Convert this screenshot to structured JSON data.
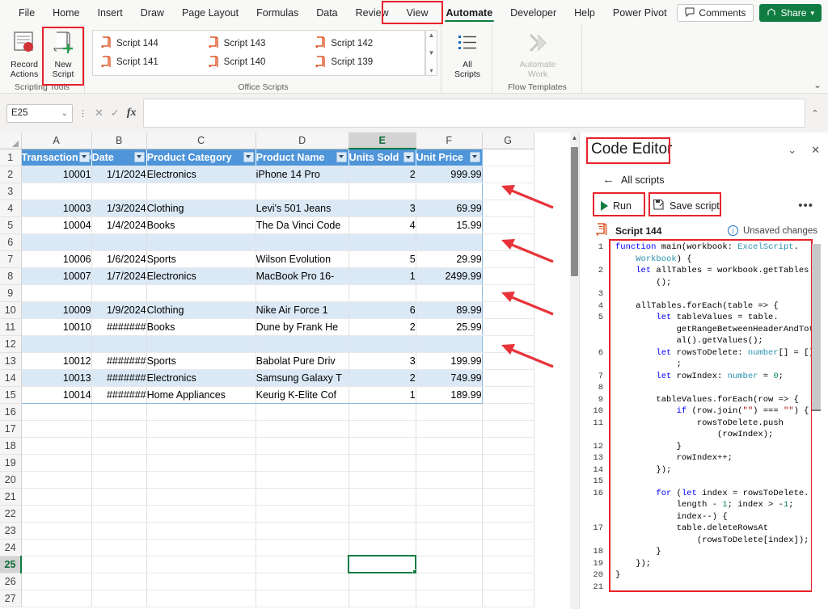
{
  "ribbon": {
    "tabs": [
      {
        "label": "File",
        "active": false
      },
      {
        "label": "Home",
        "active": false
      },
      {
        "label": "Insert",
        "active": false
      },
      {
        "label": "Draw",
        "active": false
      },
      {
        "label": "Page Layout",
        "active": false
      },
      {
        "label": "Formulas",
        "active": false
      },
      {
        "label": "Data",
        "active": false
      },
      {
        "label": "Review",
        "active": false
      },
      {
        "label": "View",
        "active": false
      },
      {
        "label": "Automate",
        "active": true
      },
      {
        "label": "Developer",
        "active": false
      },
      {
        "label": "Help",
        "active": false
      },
      {
        "label": "Power Pivot",
        "active": false
      }
    ],
    "comments_label": "Comments",
    "share_label": "Share",
    "collapse_glyph": "⌄",
    "groups": {
      "scripting_tools": {
        "label": "Scripting Tools",
        "record_actions": "Record\nActions",
        "record_actions_line1": "Record",
        "record_actions_line2": "Actions",
        "new_script_line1": "New",
        "new_script_line2": "Script"
      },
      "office_scripts": {
        "label": "Office Scripts",
        "items": [
          {
            "label": "Script 144"
          },
          {
            "label": "Script 143"
          },
          {
            "label": "Script 142"
          },
          {
            "label": "Script 141"
          },
          {
            "label": "Script 140"
          },
          {
            "label": "Script 139"
          }
        ]
      },
      "all_scripts": {
        "line1": "All",
        "line2": "Scripts"
      },
      "flow_templates": {
        "label": "Flow Templates",
        "automate_work_line1": "Automate",
        "automate_work_line2": "Work"
      }
    }
  },
  "formula_bar": {
    "name_box_value": "E25",
    "name_box_chevron": "⌄",
    "cancel_glyph": "✕",
    "confirm_glyph": "✓",
    "fx_glyph": "fx",
    "formula_value": "",
    "expand_glyph": "⌃"
  },
  "grid": {
    "column_headers": [
      "A",
      "B",
      "C",
      "D",
      "E",
      "F",
      "G"
    ],
    "selected_column": "E",
    "selected_row": "25",
    "selected_cell": "E25",
    "table_headers": [
      "Transaction ID",
      "Date",
      "Product Category",
      "Product Name",
      "Units Sold",
      "Unit Price"
    ],
    "rows": [
      {
        "n": "1",
        "type": "header"
      },
      {
        "n": "2",
        "type": "data",
        "band": true,
        "cells": [
          "10001",
          "1/1/2024",
          "Electronics",
          "iPhone 14 Pro",
          "2",
          "999.99"
        ]
      },
      {
        "n": "3",
        "type": "empty",
        "band": false,
        "arrow": true
      },
      {
        "n": "4",
        "type": "data",
        "band": true,
        "cells": [
          "10003",
          "1/3/2024",
          "Clothing",
          "Levi's 501 Jeans",
          "3",
          "69.99"
        ]
      },
      {
        "n": "5",
        "type": "data",
        "band": false,
        "cells": [
          "10004",
          "1/4/2024",
          "Books",
          "The Da Vinci Code",
          "4",
          "15.99"
        ]
      },
      {
        "n": "6",
        "type": "empty",
        "band": true,
        "arrow": true
      },
      {
        "n": "7",
        "type": "data",
        "band": false,
        "cells": [
          "10006",
          "1/6/2024",
          "Sports",
          "Wilson Evolution",
          "5",
          "29.99"
        ]
      },
      {
        "n": "8",
        "type": "data",
        "band": true,
        "cells": [
          "10007",
          "1/7/2024",
          "Electronics",
          "MacBook Pro 16-",
          "1",
          "2499.99"
        ]
      },
      {
        "n": "9",
        "type": "empty",
        "band": false,
        "arrow": true
      },
      {
        "n": "10",
        "type": "data",
        "band": true,
        "cells": [
          "10009",
          "1/9/2024",
          "Clothing",
          "Nike Air Force 1",
          "6",
          "89.99"
        ]
      },
      {
        "n": "11",
        "type": "data",
        "band": false,
        "cells": [
          "10010",
          "#######",
          "Books",
          "Dune by Frank He",
          "2",
          "25.99"
        ]
      },
      {
        "n": "12",
        "type": "empty",
        "band": true,
        "arrow": true
      },
      {
        "n": "13",
        "type": "data",
        "band": false,
        "cells": [
          "10012",
          "#######",
          "Sports",
          "Babolat Pure Driv",
          "3",
          "199.99"
        ]
      },
      {
        "n": "14",
        "type": "data",
        "band": true,
        "cells": [
          "10013",
          "#######",
          "Electronics",
          "Samsung Galaxy T",
          "2",
          "749.99"
        ]
      },
      {
        "n": "15",
        "type": "data",
        "band": false,
        "cells": [
          "10014",
          "#######",
          "Home Appliances",
          "Keurig K-Elite Cof",
          "1",
          "189.99"
        ]
      },
      {
        "n": "16",
        "type": "blank"
      },
      {
        "n": "17",
        "type": "blank"
      },
      {
        "n": "18",
        "type": "blank"
      },
      {
        "n": "19",
        "type": "blank"
      },
      {
        "n": "20",
        "type": "blank"
      },
      {
        "n": "21",
        "type": "blank"
      },
      {
        "n": "22",
        "type": "blank"
      },
      {
        "n": "23",
        "type": "blank"
      },
      {
        "n": "24",
        "type": "blank"
      },
      {
        "n": "25",
        "type": "blank",
        "selected_col_index": 4
      },
      {
        "n": "26",
        "type": "blank"
      },
      {
        "n": "27",
        "type": "blank"
      }
    ]
  },
  "code_editor": {
    "title": "Code Editor",
    "collapse_glyph": "⌄",
    "close_glyph": "✕",
    "back_glyph": "←",
    "all_scripts_label": "All scripts",
    "run_label": "Run",
    "save_label": "Save script",
    "more_label": "•••",
    "script_name": "Script 144",
    "status_label": "Unsaved changes",
    "line_numbers": [
      "1",
      "2",
      "3",
      "4",
      "5",
      "6",
      "7",
      "8",
      "9",
      "10",
      "11",
      "12",
      "13",
      "14",
      "15",
      "16",
      "17",
      "18",
      "19",
      "20",
      "21"
    ],
    "code_lines": [
      "function main(workbook: ExcelScript.",
      "    Workbook) {",
      "    let allTables = workbook.getTables",
      "        ();",
      "",
      "    allTables.forEach(table => {",
      "        let tableValues = table.",
      "            getRangeBetweenHeaderAndTot",
      "            al().getValues();",
      "        let rowsToDelete: number[] = []",
      "            ;",
      "        let rowIndex: number = 0;",
      "",
      "        tableValues.forEach(row => {",
      "            if (row.join(\"\") === \"\") {",
      "                rowsToDelete.push",
      "                    (rowIndex);",
      "            }",
      "            rowIndex++;",
      "        });",
      "",
      "        for (let index = rowsToDelete.",
      "            length - 1; index > -1;",
      "            index--) {",
      "            table.deleteRowsAt",
      "                (rowsToDelete[index]);",
      "        }",
      "    });",
      "}"
    ]
  },
  "colors": {
    "accent_green": "#107c41",
    "table_header_blue": "#4e95d9",
    "table_band_blue": "#dbe9f7",
    "annotation_red": "#e8222b",
    "code_keyword_blue": "#0000ff",
    "code_type_teal": "#2b91af",
    "code_string_red": "#a31515"
  }
}
